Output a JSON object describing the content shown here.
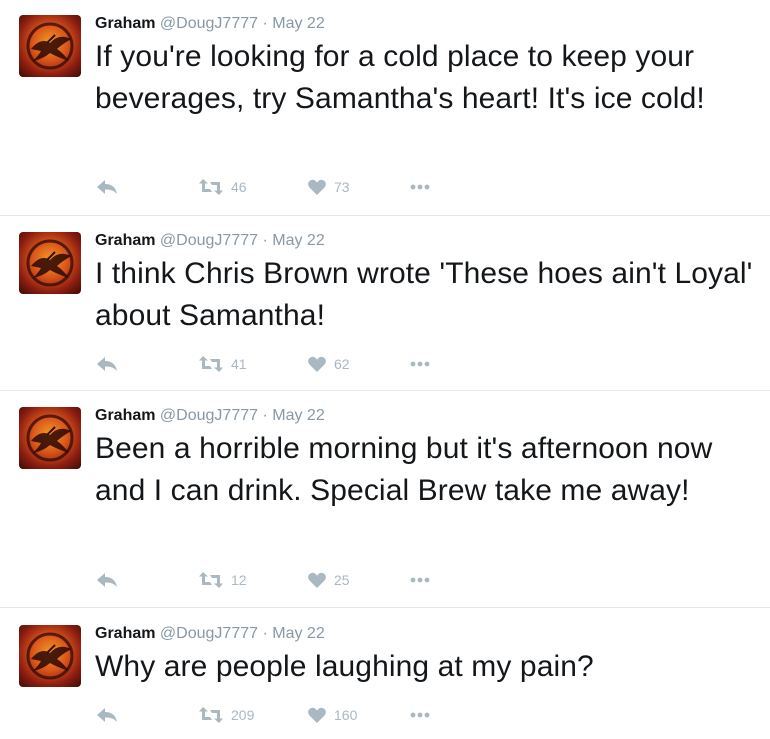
{
  "tweets": [
    {
      "name": "Graham",
      "handle": "@DougJ7777",
      "dot": "·",
      "date": "May 22",
      "text": "If you're looking for a cold place to keep your beverages, try Samantha's heart! It's ice cold!",
      "retweets": "46",
      "likes": "73"
    },
    {
      "name": "Graham",
      "handle": "@DougJ7777",
      "dot": "·",
      "date": "May 22",
      "text": "I think Chris Brown wrote 'These hoes ain't Loyal' about Samantha!",
      "retweets": "41",
      "likes": "62"
    },
    {
      "name": "Graham",
      "handle": "@DougJ7777",
      "dot": "·",
      "date": "May 22",
      "text": "Been a horrible morning but it's afternoon now and I can drink. Special Brew take me away!",
      "retweets": "12",
      "likes": "25"
    },
    {
      "name": "Graham",
      "handle": "@DougJ7777",
      "dot": "·",
      "date": "May 22",
      "text": "Why are people laughing at my pain?",
      "retweets": "209",
      "likes": "160"
    }
  ],
  "icons": {
    "avatar": "mockingjay-logo",
    "reply": "reply-icon",
    "retweet": "retweet-icon",
    "like": "heart-icon",
    "more": "more-dots-icon"
  },
  "colors": {
    "text": "#14171a",
    "meta": "#8899a6",
    "action": "#aab8c2",
    "divider": "#e1e8ed"
  }
}
